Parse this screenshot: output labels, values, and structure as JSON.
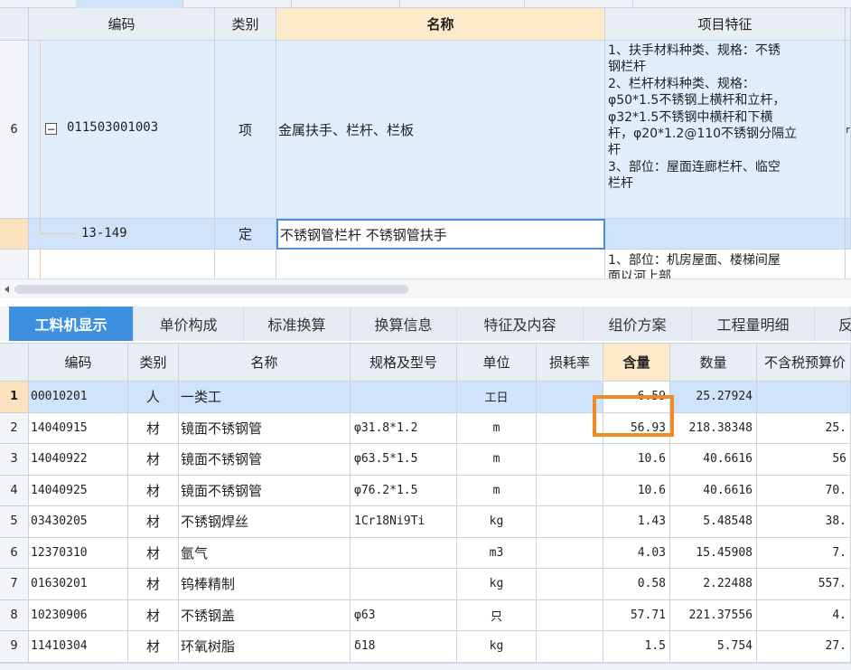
{
  "upper": {
    "headers": {
      "code": "编码",
      "type": "类别",
      "name": "名称",
      "feature": "项目特征"
    },
    "row6": {
      "num": "6",
      "code": "011503001003",
      "type": "项",
      "name": "金属扶手、栏杆、栏板",
      "feature_lines": [
        "1、扶手材料种类、规格：不锈",
        "钢栏杆",
        "2、栏杆材料种类、规格：",
        "φ50*1.5不锈钢上横杆和立杆，",
        "φ32*1.5不锈钢中横杆和下横",
        "杆，φ20*1.2@110不锈钢分隔立",
        "杆",
        "3、部位：屋面连廊栏杆、临空",
        "栏杆"
      ],
      "edge_mark": "r"
    },
    "sub": {
      "code": "13-149",
      "type": "定",
      "name": "不锈钢管栏杆 不锈钢管扶手"
    },
    "next_feature_lines": [
      "1、部位：机房屋面、楼梯间屋",
      "面以河上部"
    ]
  },
  "tabs": [
    "工料机显示",
    "单价构成",
    "标准换算",
    "换算信息",
    "特征及内容",
    "组价方案",
    "工程量明细",
    "反"
  ],
  "lower": {
    "headers": [
      "编码",
      "类别",
      "名称",
      "规格及型号",
      "单位",
      "损耗率",
      "含量",
      "数量",
      "不含税预算价"
    ],
    "rows": [
      {
        "num": "1",
        "code": "00010201",
        "type": "人",
        "name": "一类工",
        "spec": "",
        "unit": "工日",
        "loss": "",
        "content": "6.59",
        "qty": "25.27924",
        "price": ""
      },
      {
        "num": "2",
        "code": "14040915",
        "type": "材",
        "name": "镜面不锈钢管",
        "spec": "φ31.8*1.2",
        "unit": "m",
        "loss": "",
        "content": "56.93",
        "qty": "218.38348",
        "price": "25."
      },
      {
        "num": "3",
        "code": "14040922",
        "type": "材",
        "name": "镜面不锈钢管",
        "spec": "φ63.5*1.5",
        "unit": "m",
        "loss": "",
        "content": "10.6",
        "qty": "40.6616",
        "price": "56"
      },
      {
        "num": "4",
        "code": "14040925",
        "type": "材",
        "name": "镜面不锈钢管",
        "spec": "φ76.2*1.5",
        "unit": "m",
        "loss": "",
        "content": "10.6",
        "qty": "40.6616",
        "price": "70."
      },
      {
        "num": "5",
        "code": "03430205",
        "type": "材",
        "name": "不锈钢焊丝",
        "spec": "1Cr18Ni9Ti",
        "unit": "kg",
        "loss": "",
        "content": "1.43",
        "qty": "5.48548",
        "price": "38."
      },
      {
        "num": "6",
        "code": "12370310",
        "type": "材",
        "name": "氩气",
        "spec": "",
        "unit": "m3",
        "loss": "",
        "content": "4.03",
        "qty": "15.45908",
        "price": "7."
      },
      {
        "num": "7",
        "code": "01630201",
        "type": "材",
        "name": "钨棒精制",
        "spec": "",
        "unit": "kg",
        "loss": "",
        "content": "0.58",
        "qty": "2.22488",
        "price": "557."
      },
      {
        "num": "8",
        "code": "10230906",
        "type": "材",
        "name": "不锈钢盖",
        "spec": "φ63",
        "unit": "只",
        "loss": "",
        "content": "57.71",
        "qty": "221.37556",
        "price": "4."
      },
      {
        "num": "9",
        "code": "11410304",
        "type": "材",
        "name": "环氧树脂",
        "spec": "δ18",
        "unit": "kg",
        "loss": "",
        "content": "1.5",
        "qty": "5.754",
        "price": "27."
      }
    ]
  },
  "colors": {
    "highlight_box": "#f08a24",
    "selected_row": "#cfe3fb",
    "tab_active": "#3d8fe0",
    "name_header": "#fdeacb"
  }
}
